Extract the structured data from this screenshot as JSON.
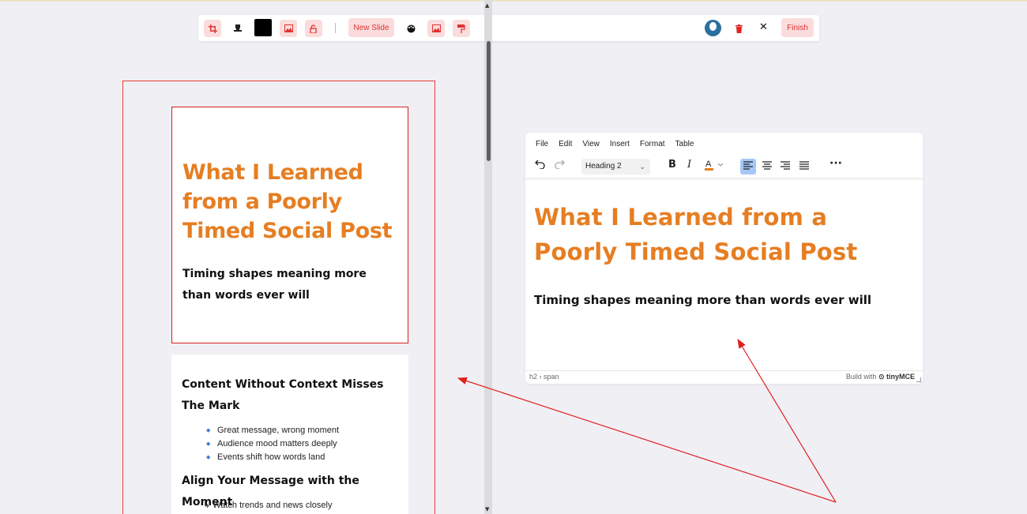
{
  "toolbar": {
    "new_slide_label": "New Slide",
    "finish_label": "Finish",
    "close_glyph": "✕",
    "colors": {
      "swatch": "#000000",
      "accent_bg": "#fbdcdc",
      "accent": "#dd3333"
    },
    "icons": [
      "crop-icon",
      "stamp-icon",
      "color-swatch",
      "image-icon",
      "lock-icon",
      "palette-icon",
      "image-icon",
      "paint-roller-icon",
      "avatar",
      "trash-icon",
      "close-icon"
    ]
  },
  "preview": {
    "slide1": {
      "title": "What I Learned from a Poorly Timed Social Post",
      "subtitle": "Timing shapes meaning more than words ever will"
    },
    "slide2": {
      "heading1": "Content Without Context Misses The Mark",
      "bullets": [
        "Great message, wrong moment",
        "Audience mood matters deeply",
        "Events shift how words land"
      ],
      "heading2": "Align Your Message with the Moment",
      "sub_item": "↳ Watch trends and news closely"
    }
  },
  "editor": {
    "menu": [
      "File",
      "Edit",
      "View",
      "Insert",
      "Format",
      "Table"
    ],
    "block_format": "Heading 2",
    "content_title": "What I Learned from a Poorly Timed Social Post",
    "content_subtitle": "Timing shapes meaning more than words ever will",
    "path": "h2 › span",
    "brand_prefix": "Build with",
    "brand_name": "tinyMCE",
    "colors": {
      "heading": "#e67e22",
      "active_align": "#a6c8f7"
    }
  }
}
